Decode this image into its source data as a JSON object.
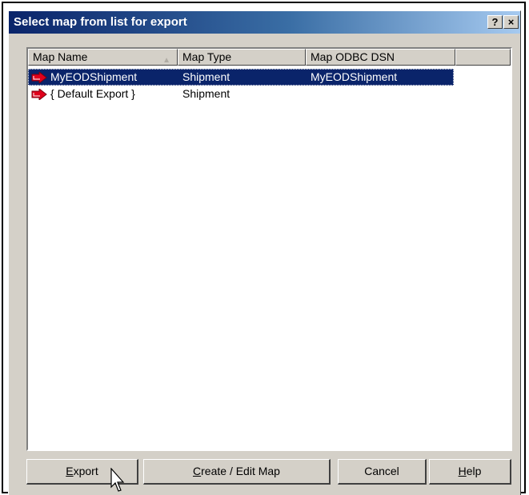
{
  "window": {
    "title": "Select map from list for export",
    "help_btn": "?",
    "close_btn": "×"
  },
  "list": {
    "columns": [
      "Map Name",
      "Map Type",
      "Map ODBC DSN"
    ],
    "rows": [
      {
        "name": "MyEODShipment",
        "type": "Shipment",
        "dsn": "MyEODShipment",
        "selected": true
      },
      {
        "name": "{ Default Export }",
        "type": "Shipment",
        "dsn": "",
        "selected": false
      }
    ]
  },
  "buttons": {
    "export": {
      "mnemonic": "E",
      "rest": "xport"
    },
    "create_edit": {
      "mnemonic": "C",
      "rest": "reate / Edit Map"
    },
    "cancel": "Cancel",
    "help": {
      "mnemonic": "H",
      "rest": "elp"
    }
  },
  "colors": {
    "selection": "#0a246a",
    "face": "#d4d0c8",
    "arrow_icon": "#e0001b"
  }
}
